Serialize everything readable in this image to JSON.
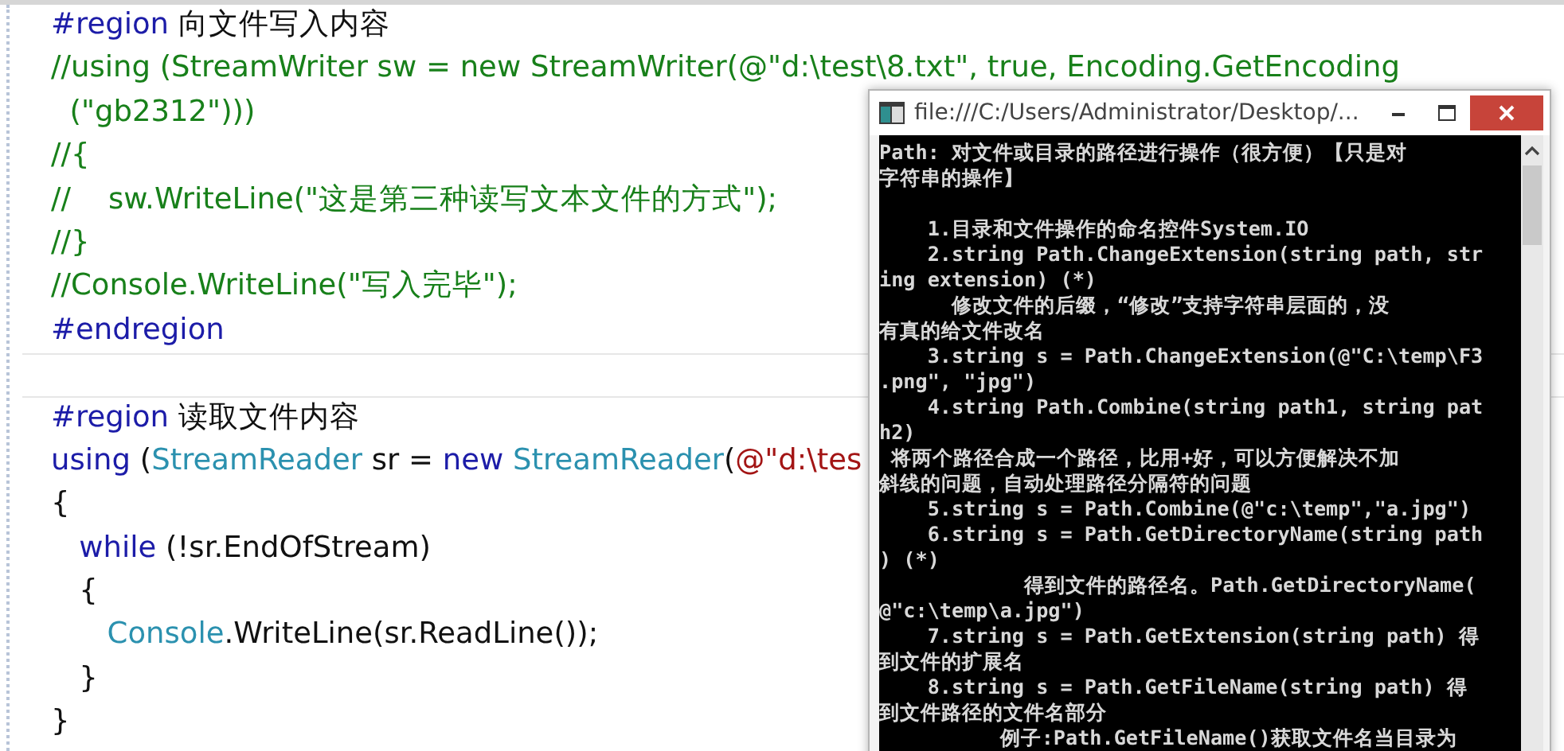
{
  "editor": {
    "lines": [
      {
        "tokens": [
          {
            "kind": "keyword",
            "text": "#region"
          },
          {
            "kind": "plain",
            "text": " 向文件写入内容"
          }
        ]
      },
      {
        "tokens": [
          {
            "kind": "comment",
            "text": "//using (StreamWriter sw = new StreamWriter(@\"d:\\test\\8.txt\", true, Encoding.GetEncoding"
          }
        ]
      },
      {
        "tokens": [
          {
            "kind": "comment",
            "text": "  (\"gb2312\")))"
          }
        ]
      },
      {
        "tokens": [
          {
            "kind": "comment",
            "text": "//{"
          }
        ]
      },
      {
        "tokens": [
          {
            "kind": "comment",
            "text": "//    sw.WriteLine(\"这是第三种读写文本文件的方式\");"
          }
        ]
      },
      {
        "tokens": [
          {
            "kind": "comment",
            "text": "//}"
          }
        ]
      },
      {
        "tokens": [
          {
            "kind": "comment",
            "text": "//Console.WriteLine(\"写入完毕\");"
          }
        ]
      },
      {
        "tokens": [
          {
            "kind": "keyword",
            "text": "#endregion"
          }
        ]
      },
      {
        "blank_before": true,
        "tokens": [
          {
            "kind": "keyword",
            "text": "#region"
          },
          {
            "kind": "plain",
            "text": " 读取文件内容"
          }
        ]
      },
      {
        "tokens": [
          {
            "kind": "keyword",
            "text": "using"
          },
          {
            "kind": "plain",
            "text": " ("
          },
          {
            "kind": "type",
            "text": "StreamReader"
          },
          {
            "kind": "plain",
            "text": " sr = "
          },
          {
            "kind": "keyword",
            "text": "new "
          },
          {
            "kind": "type",
            "text": "StreamReader"
          },
          {
            "kind": "plain",
            "text": "("
          },
          {
            "kind": "string",
            "text": "@\"d:\\tes"
          }
        ]
      },
      {
        "tokens": [
          {
            "kind": "plain",
            "text": "{"
          }
        ]
      },
      {
        "tokens": [
          {
            "kind": "keyword",
            "text": "   while"
          },
          {
            "kind": "plain",
            "text": " (!sr.EndOfStream)"
          }
        ]
      },
      {
        "tokens": [
          {
            "kind": "plain",
            "text": "   {"
          }
        ]
      },
      {
        "tokens": [
          {
            "kind": "type",
            "text": "      Console"
          },
          {
            "kind": "plain",
            "text": ".WriteLine(sr.ReadLine());"
          }
        ]
      },
      {
        "tokens": [
          {
            "kind": "plain",
            "text": "   }"
          }
        ]
      },
      {
        "tokens": [
          {
            "kind": "plain",
            "text": "}"
          }
        ]
      }
    ]
  },
  "console": {
    "title": "file:///C:/Users/Administrator/Desktop/...",
    "heading": [
      "Path: 对文件或目录的路径进行操作（很方便）【只是对",
      "字符串的操作】"
    ],
    "lines": [
      "    1.目录和文件操作的命名控件System.IO",
      "    2.string Path.ChangeExtension(string path, str",
      "ing extension) (*)",
      "      修改文件的后缀，“修改”支持字符串层面的，没",
      "有真的给文件改名",
      "    3.string s = Path.ChangeExtension(@\"C:\\temp\\F3",
      ".png\", \"jpg\")",
      "    4.string Path.Combine(string path1, string pat",
      "h2)",
      " 将两个路径合成一个路径，比用+好，可以方便解决不加",
      "斜线的问题，自动处理路径分隔符的问题",
      "    5.string s = Path.Combine(@\"c:\\temp\",\"a.jpg\")",
      "    6.string s = Path.GetDirectoryName(string path",
      ") (*)",
      "            得到文件的路径名。Path.GetDirectoryName(",
      "@\"c:\\temp\\a.jpg\")",
      "    7.string s = Path.GetExtension(string path) 得",
      "到文件的扩展名",
      "    8.string s = Path.GetFileName(string path) 得",
      "到文件路径的文件名部分",
      "          例子:Path.GetFileName()获取文件名当目录为"
    ]
  }
}
